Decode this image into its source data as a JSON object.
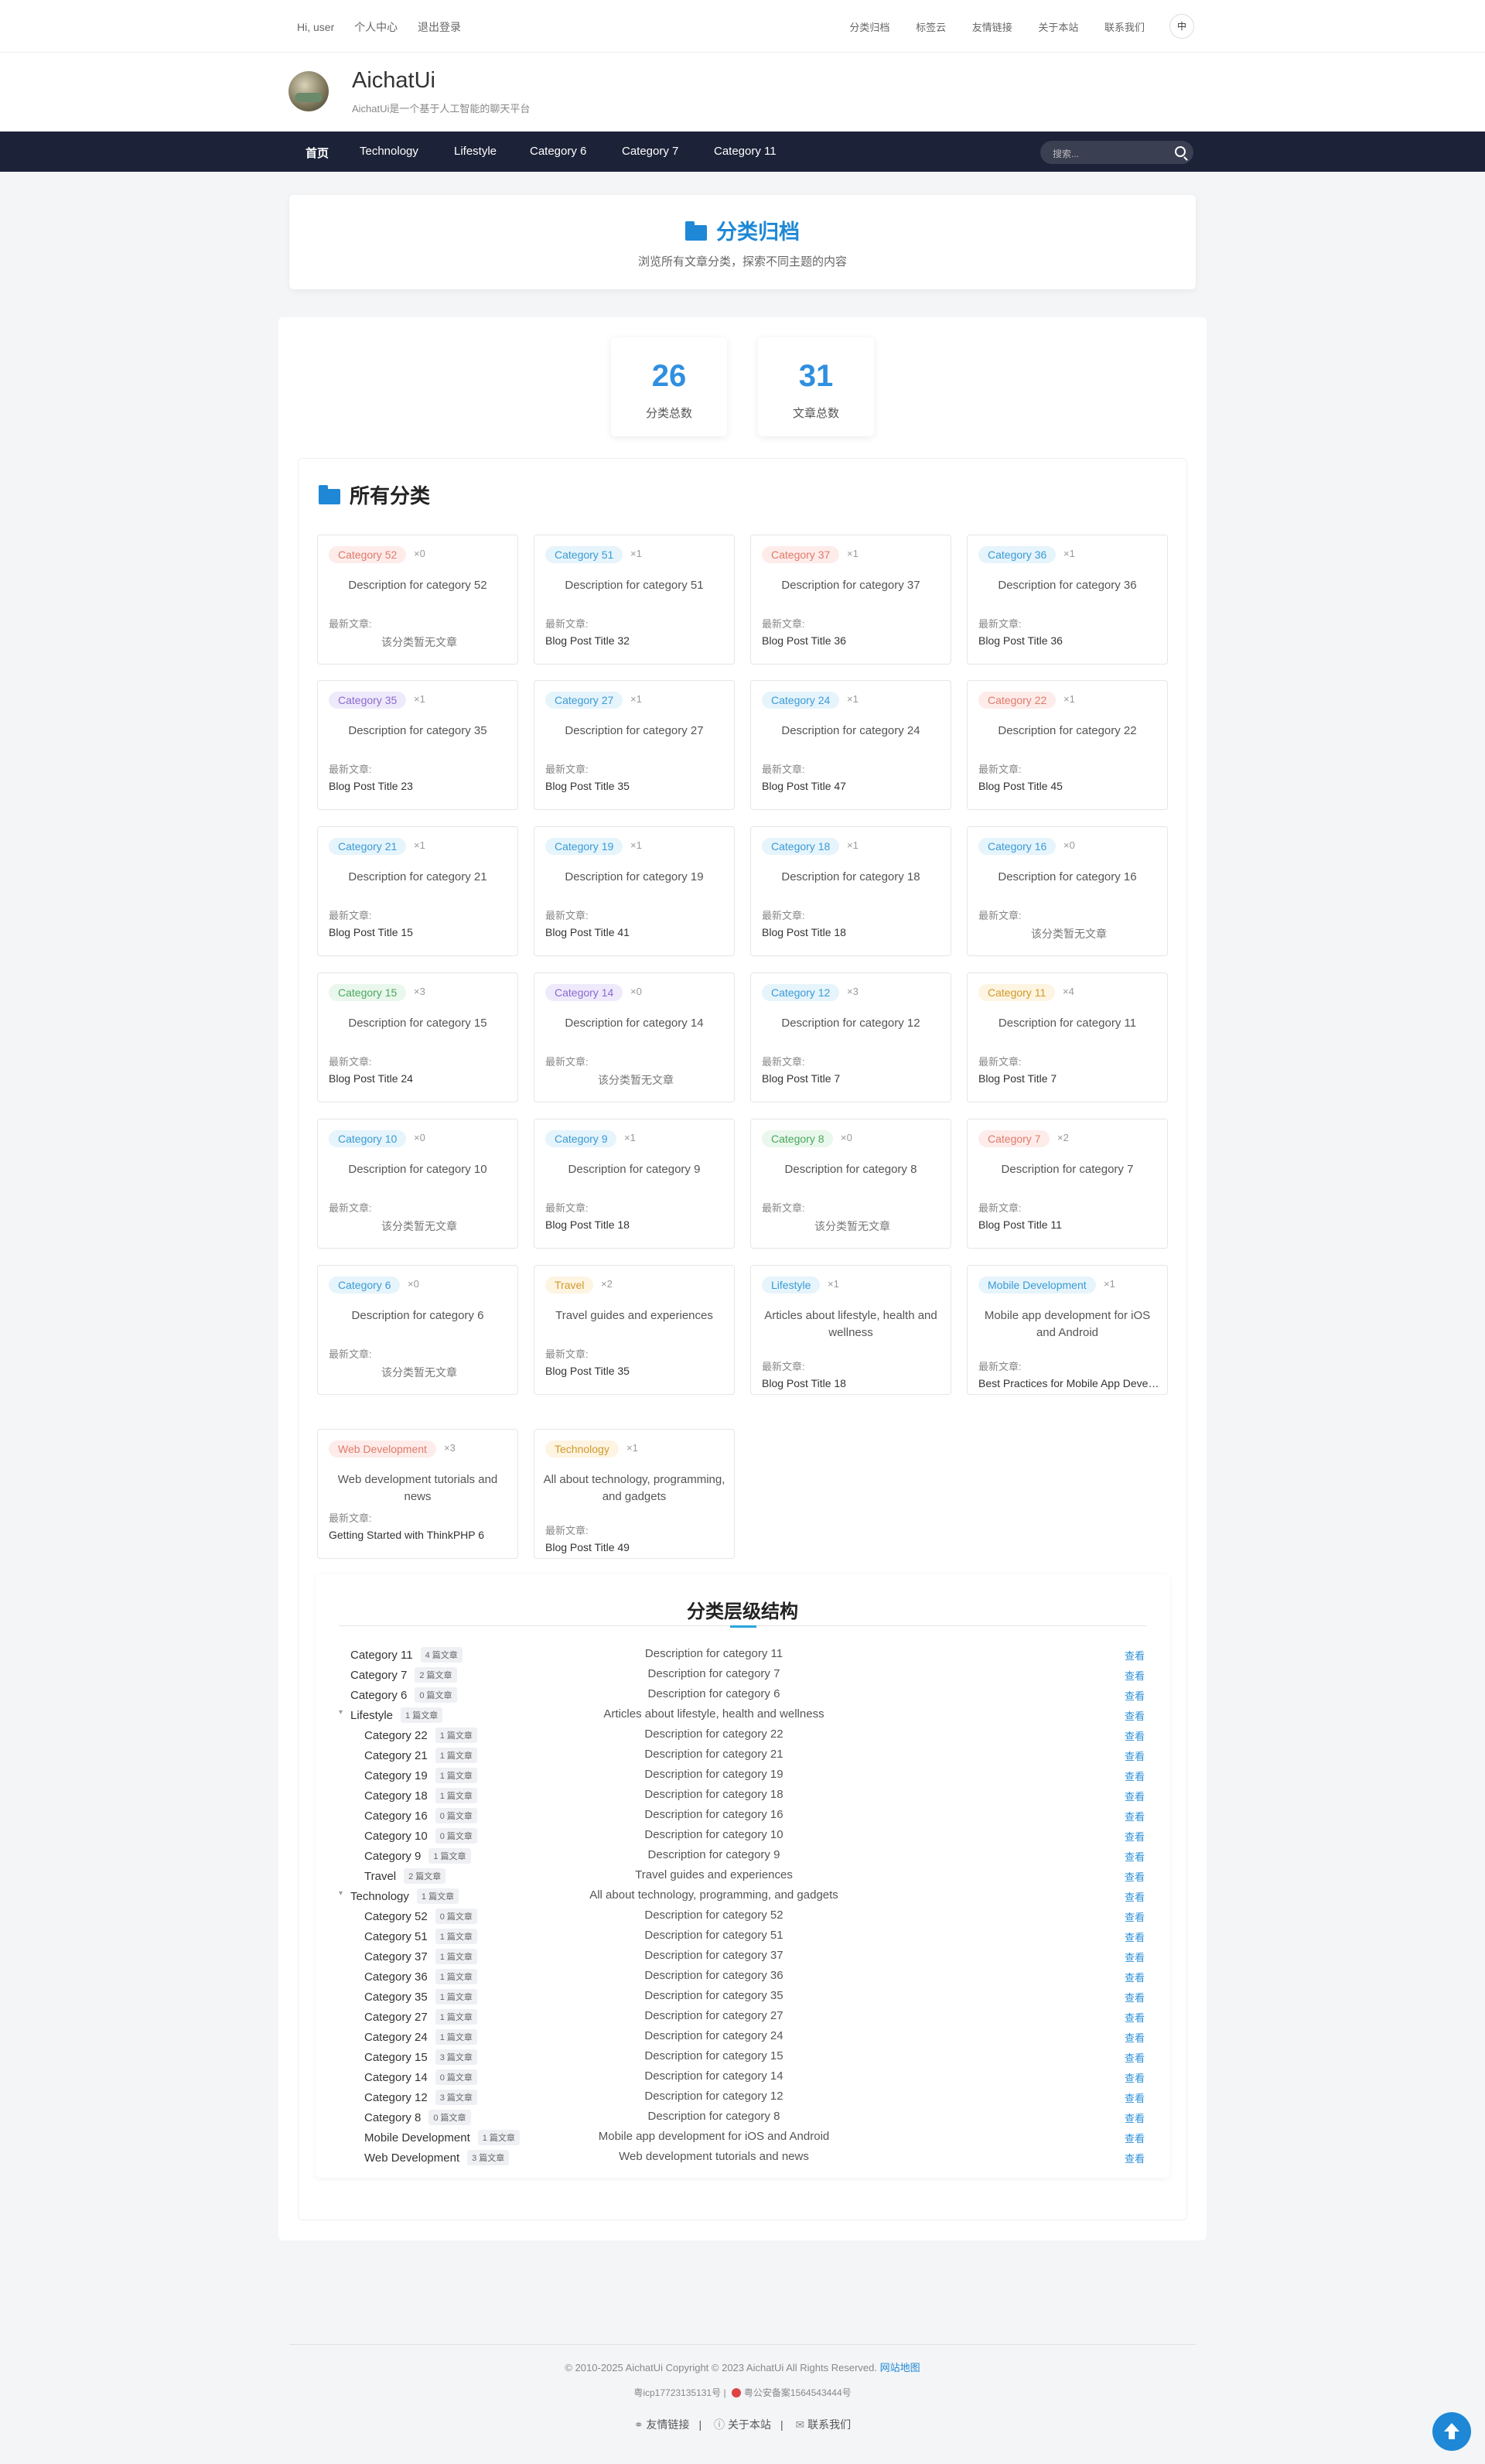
{
  "topbar": {
    "greeting": "Hi, user",
    "profile": "个人中心",
    "logout": "退出登录",
    "links": [
      "分类归档",
      "标签云",
      "友情链接",
      "关于本站",
      "联系我们"
    ],
    "lang": "中"
  },
  "site": {
    "name": "AichatUi",
    "slogan": "AichatUi是一个基于人工智能的聊天平台"
  },
  "nav": {
    "items": [
      "首页",
      "Technology",
      "Lifestyle",
      "Category 6",
      "Category 7",
      "Category 11"
    ],
    "search_placeholder": "搜索..."
  },
  "hero": {
    "title": "分类归档",
    "subtitle": "浏览所有文章分类，探索不同主题的内容"
  },
  "stats": [
    {
      "value": "26",
      "label": "分类总数"
    },
    {
      "value": "31",
      "label": "文章总数"
    }
  ],
  "all_title": "所有分类",
  "latest_label": "最新文章:",
  "cards": [
    {
      "tag": "Category 52",
      "count": "×0",
      "desc": "Description for category 52",
      "latest": "该分类暂无文章",
      "empty": true,
      "color": "#fdecea",
      "fg": "#e07a6a"
    },
    {
      "tag": "Category 51",
      "count": "×1",
      "desc": "Description for category 51",
      "latest": "Blog Post Title 32",
      "empty": false,
      "color": "#e6f4fb",
      "fg": "#3a9bd6"
    },
    {
      "tag": "Category 37",
      "count": "×1",
      "desc": "Description for category 37",
      "latest": "Blog Post Title 36",
      "empty": false,
      "color": "#fdecea",
      "fg": "#e07a6a"
    },
    {
      "tag": "Category 36",
      "count": "×1",
      "desc": "Description for category 36",
      "latest": "Blog Post Title 36",
      "empty": false,
      "color": "#e6f4fb",
      "fg": "#3a9bd6"
    },
    {
      "tag": "Category 35",
      "count": "×1",
      "desc": "Description for category 35",
      "latest": "Blog Post Title 23",
      "empty": false,
      "color": "#efeafb",
      "fg": "#8a6ad0"
    },
    {
      "tag": "Category 27",
      "count": "×1",
      "desc": "Description for category 27",
      "latest": "Blog Post Title 35",
      "empty": false,
      "color": "#e6f4fb",
      "fg": "#3a9bd6"
    },
    {
      "tag": "Category 24",
      "count": "×1",
      "desc": "Description for category 24",
      "latest": "Blog Post Title 47",
      "empty": false,
      "color": "#e6f4fb",
      "fg": "#3a9bd6"
    },
    {
      "tag": "Category 22",
      "count": "×1",
      "desc": "Description for category 22",
      "latest": "Blog Post Title 45",
      "empty": false,
      "color": "#fdecea",
      "fg": "#e07a6a"
    },
    {
      "tag": "Category 21",
      "count": "×1",
      "desc": "Description for category 21",
      "latest": "Blog Post Title 15",
      "empty": false,
      "color": "#e6f4fb",
      "fg": "#3a9bd6"
    },
    {
      "tag": "Category 19",
      "count": "×1",
      "desc": "Description for category 19",
      "latest": "Blog Post Title 41",
      "empty": false,
      "color": "#e6f4fb",
      "fg": "#3a9bd6"
    },
    {
      "tag": "Category 18",
      "count": "×1",
      "desc": "Description for category 18",
      "latest": "Blog Post Title 18",
      "empty": false,
      "color": "#e6f4fb",
      "fg": "#3a9bd6"
    },
    {
      "tag": "Category 16",
      "count": "×0",
      "desc": "Description for category 16",
      "latest": "该分类暂无文章",
      "empty": true,
      "color": "#e6f4fb",
      "fg": "#3a9bd6"
    },
    {
      "tag": "Category 15",
      "count": "×3",
      "desc": "Description for category 15",
      "latest": "Blog Post Title 24",
      "empty": false,
      "color": "#eaf7ec",
      "fg": "#4aa860"
    },
    {
      "tag": "Category 14",
      "count": "×0",
      "desc": "Description for category 14",
      "latest": "该分类暂无文章",
      "empty": true,
      "color": "#efeafb",
      "fg": "#8a6ad0"
    },
    {
      "tag": "Category 12",
      "count": "×3",
      "desc": "Description for category 12",
      "latest": "Blog Post Title 7",
      "empty": false,
      "color": "#e6f4fb",
      "fg": "#3a9bd6"
    },
    {
      "tag": "Category 11",
      "count": "×4",
      "desc": "Description for category 11",
      "latest": "Blog Post Title 7",
      "empty": false,
      "color": "#fdf4e2",
      "fg": "#d19a2a"
    },
    {
      "tag": "Category 10",
      "count": "×0",
      "desc": "Description for category 10",
      "latest": "该分类暂无文章",
      "empty": true,
      "color": "#e6f4fb",
      "fg": "#3a9bd6"
    },
    {
      "tag": "Category 9",
      "count": "×1",
      "desc": "Description for category 9",
      "latest": "Blog Post Title 18",
      "empty": false,
      "color": "#e6f4fb",
      "fg": "#3a9bd6"
    },
    {
      "tag": "Category 8",
      "count": "×0",
      "desc": "Description for category 8",
      "latest": "该分类暂无文章",
      "empty": true,
      "color": "#eaf7ec",
      "fg": "#4aa860"
    },
    {
      "tag": "Category 7",
      "count": "×2",
      "desc": "Description for category 7",
      "latest": "Blog Post Title 11",
      "empty": false,
      "color": "#fdecea",
      "fg": "#e07a6a"
    },
    {
      "tag": "Category 6",
      "count": "×0",
      "desc": "Description for category 6",
      "latest": "该分类暂无文章",
      "empty": true,
      "color": "#e6f4fb",
      "fg": "#3a9bd6"
    },
    {
      "tag": "Travel",
      "count": "×2",
      "desc": "Travel guides and experiences",
      "latest": "Blog Post Title 35",
      "empty": false,
      "color": "#fdf4e2",
      "fg": "#d19a2a"
    },
    {
      "tag": "Lifestyle",
      "count": "×1",
      "desc": "Articles about lifestyle, health and wellness",
      "latest": "Blog Post Title 18",
      "empty": false,
      "color": "#e6f4fb",
      "fg": "#3a9bd6"
    },
    {
      "tag": "Mobile Development",
      "count": "×1",
      "desc": "Mobile app development for iOS and Android",
      "latest": "Best Practices for Mobile App Development",
      "empty": false,
      "color": "#e6f4fb",
      "fg": "#3a9bd6"
    },
    {
      "tag": "Web Development",
      "count": "×3",
      "desc": "Web development tutorials and news",
      "latest": "Getting Started with ThinkPHP 6",
      "empty": false,
      "color": "#fdecea",
      "fg": "#e07a6a"
    },
    {
      "tag": "Technology",
      "count": "×1",
      "desc": "All about technology, programming, and gadgets",
      "latest": "Blog Post Title 49",
      "empty": false,
      "color": "#fdf4e2",
      "fg": "#d19a2a"
    }
  ],
  "tree": {
    "title": "分类层级结构",
    "view": "查看",
    "rows": [
      {
        "name": "Category 11",
        "count": "4 篇文章",
        "desc": "Description for category 11",
        "level": 0,
        "toggle": ""
      },
      {
        "name": "Category 7",
        "count": "2 篇文章",
        "desc": "Description for category 7",
        "level": 0,
        "toggle": ""
      },
      {
        "name": "Category 6",
        "count": "0 篇文章",
        "desc": "Description for category 6",
        "level": 0,
        "toggle": ""
      },
      {
        "name": "Lifestyle",
        "count": "1 篇文章",
        "desc": "Articles about lifestyle, health and wellness",
        "level": 0,
        "toggle": "▾"
      },
      {
        "name": "Category 22",
        "count": "1 篇文章",
        "desc": "Description for category 22",
        "level": 1,
        "toggle": ""
      },
      {
        "name": "Category 21",
        "count": "1 篇文章",
        "desc": "Description for category 21",
        "level": 1,
        "toggle": ""
      },
      {
        "name": "Category 19",
        "count": "1 篇文章",
        "desc": "Description for category 19",
        "level": 1,
        "toggle": ""
      },
      {
        "name": "Category 18",
        "count": "1 篇文章",
        "desc": "Description for category 18",
        "level": 1,
        "toggle": ""
      },
      {
        "name": "Category 16",
        "count": "0 篇文章",
        "desc": "Description for category 16",
        "level": 1,
        "toggle": ""
      },
      {
        "name": "Category 10",
        "count": "0 篇文章",
        "desc": "Description for category 10",
        "level": 1,
        "toggle": ""
      },
      {
        "name": "Category 9",
        "count": "1 篇文章",
        "desc": "Description for category 9",
        "level": 1,
        "toggle": ""
      },
      {
        "name": "Travel",
        "count": "2 篇文章",
        "desc": "Travel guides and experiences",
        "level": 1,
        "toggle": ""
      },
      {
        "name": "Technology",
        "count": "1 篇文章",
        "desc": "All about technology, programming, and gadgets",
        "level": 0,
        "toggle": "▾"
      },
      {
        "name": "Category 52",
        "count": "0 篇文章",
        "desc": "Description for category 52",
        "level": 1,
        "toggle": ""
      },
      {
        "name": "Category 51",
        "count": "1 篇文章",
        "desc": "Description for category 51",
        "level": 1,
        "toggle": ""
      },
      {
        "name": "Category 37",
        "count": "1 篇文章",
        "desc": "Description for category 37",
        "level": 1,
        "toggle": ""
      },
      {
        "name": "Category 36",
        "count": "1 篇文章",
        "desc": "Description for category 36",
        "level": 1,
        "toggle": ""
      },
      {
        "name": "Category 35",
        "count": "1 篇文章",
        "desc": "Description for category 35",
        "level": 1,
        "toggle": ""
      },
      {
        "name": "Category 27",
        "count": "1 篇文章",
        "desc": "Description for category 27",
        "level": 1,
        "toggle": ""
      },
      {
        "name": "Category 24",
        "count": "1 篇文章",
        "desc": "Description for category 24",
        "level": 1,
        "toggle": ""
      },
      {
        "name": "Category 15",
        "count": "3 篇文章",
        "desc": "Description for category 15",
        "level": 1,
        "toggle": ""
      },
      {
        "name": "Category 14",
        "count": "0 篇文章",
        "desc": "Description for category 14",
        "level": 1,
        "toggle": ""
      },
      {
        "name": "Category 12",
        "count": "3 篇文章",
        "desc": "Description for category 12",
        "level": 1,
        "toggle": ""
      },
      {
        "name": "Category 8",
        "count": "0 篇文章",
        "desc": "Description for category 8",
        "level": 1,
        "toggle": ""
      },
      {
        "name": "Mobile Development",
        "count": "1 篇文章",
        "desc": "Mobile app development for iOS and Android",
        "level": 1,
        "toggle": ""
      },
      {
        "name": "Web Development",
        "count": "3 篇文章",
        "desc": "Web development tutorials and news",
        "level": 1,
        "toggle": ""
      }
    ]
  },
  "footer": {
    "copyright": "© 2010-2025 AichatUi Copyright © 2023 AichatUi All Rights Reserved.",
    "sitemap": "网站地图",
    "icp": "粤icp17723135131号",
    "police": "粤公安备案1564543444号",
    "links": [
      "友情链接",
      "关于本站",
      "联系我们"
    ]
  }
}
